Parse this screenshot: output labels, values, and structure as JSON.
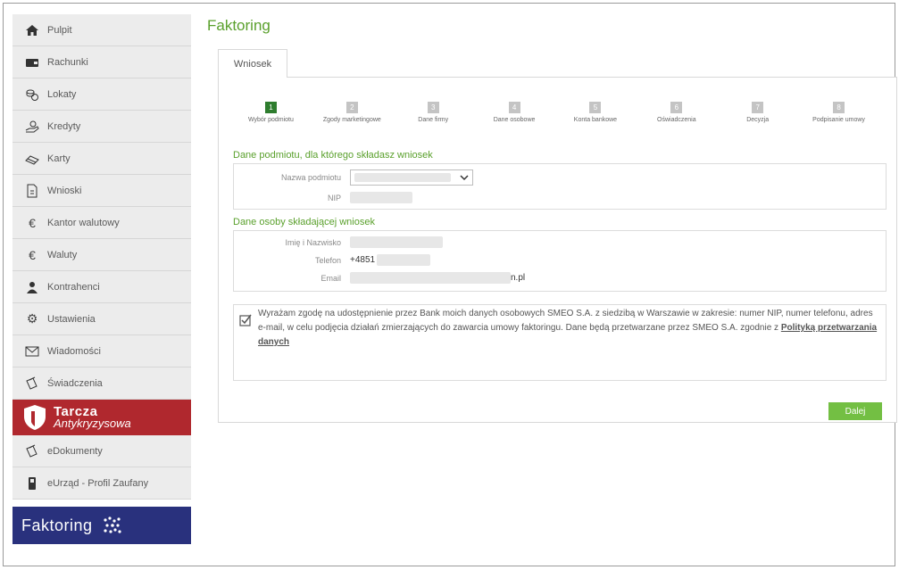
{
  "sidebar": {
    "items": [
      {
        "label": "Pulpit",
        "icon": "home-icon"
      },
      {
        "label": "Rachunki",
        "icon": "wallet-icon"
      },
      {
        "label": "Lokaty",
        "icon": "coins-icon"
      },
      {
        "label": "Kredyty",
        "icon": "hand-coins-icon"
      },
      {
        "label": "Karty",
        "icon": "card-icon"
      },
      {
        "label": "Wnioski",
        "icon": "document-icon"
      },
      {
        "label": "Kantor walutowy",
        "icon": "euro-icon"
      },
      {
        "label": "Waluty",
        "icon": "euro-icon"
      },
      {
        "label": "Kontrahenci",
        "icon": "people-icon"
      },
      {
        "label": "Ustawienia",
        "icon": "gear-icon"
      },
      {
        "label": "Wiadomości",
        "icon": "envelope-icon"
      },
      {
        "label": "Świadczenia",
        "icon": "documents-icon"
      }
    ],
    "tarcza": {
      "line1": "Tarcza",
      "line2": "Antykryzysowa"
    },
    "items2": [
      {
        "label": "eDokumenty",
        "icon": "documents-icon"
      },
      {
        "label": "eUrząd - Profil Zaufany",
        "icon": "id-icon"
      }
    ],
    "faktoring": "Faktoring"
  },
  "main": {
    "title": "Faktoring",
    "tab": "Wniosek",
    "steps": [
      {
        "num": "1",
        "label": "Wybór podmiotu"
      },
      {
        "num": "2",
        "label": "Zgody marketingowe"
      },
      {
        "num": "3",
        "label": "Dane firmy"
      },
      {
        "num": "4",
        "label": "Dane osobowe"
      },
      {
        "num": "5",
        "label": "Konta bankowe"
      },
      {
        "num": "6",
        "label": "Oświadczenia"
      },
      {
        "num": "7",
        "label": "Decyzja"
      },
      {
        "num": "8",
        "label": "Podpisanie umowy"
      }
    ],
    "section1": {
      "title": "Dane podmiotu, dla którego składasz wniosek",
      "name_label": "Nazwa podmiotu",
      "nip_label": "NIP"
    },
    "section2": {
      "title": "Dane osoby składającej wniosek",
      "name_label": "Imię i Nazwisko",
      "phone_label": "Telefon",
      "phone_value": "+4851",
      "email_label": "Email",
      "email_value": "n.pl"
    },
    "consent": {
      "text": "Wyrażam zgodę na udostępnienie przez Bank moich danych osobowych SMEO S.A. z siedzibą w Warszawie w zakresie: numer NIP, numer telefonu, adres e-mail, w celu podjęcia działań zmierzających do zawarcia umowy faktoringu. Dane będą przetwarzane przez SMEO S.A. zgodnie z ",
      "link": "Polityką przetwarzania danych"
    },
    "next_button": "Dalej"
  },
  "colors": {
    "accent_green": "#5aa02c",
    "button_green": "#73bf43",
    "tarcza_red": "#b0282e",
    "faktoring_blue": "#29317d"
  }
}
